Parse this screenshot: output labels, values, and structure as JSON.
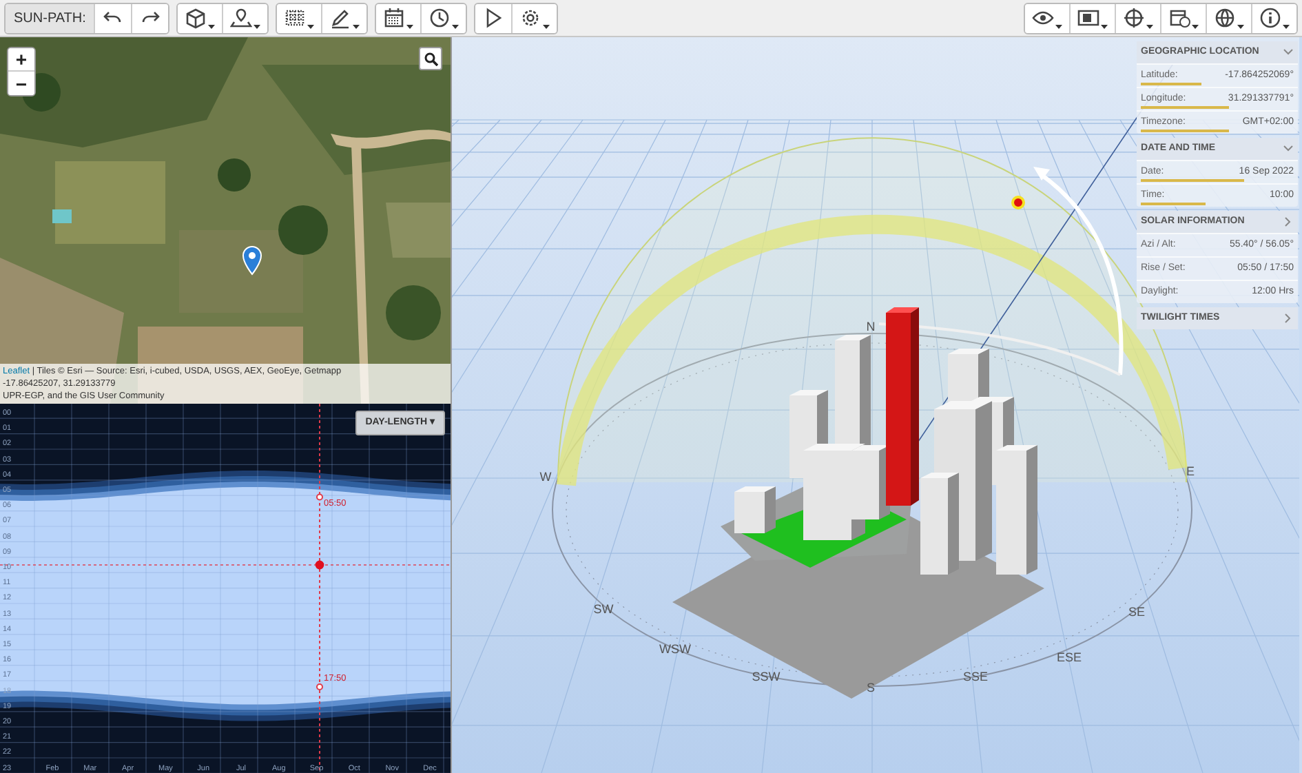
{
  "toolbar": {
    "title": "SUN-PATH:"
  },
  "map": {
    "zoom_in": "+",
    "zoom_out": "−",
    "attribution_link": "Leaflet",
    "attribution": "| Tiles © Esri — Source: Esri, i-cubed, USDA, USGS, AEX, GeoEye, Getmapp",
    "coordinates": "-17.86425207, 31.29133779",
    "attribution_line2": "UPR-EGP, and the GIS User Community"
  },
  "day_length": {
    "dropdown": "DAY-LENGTH ▾",
    "hours": [
      "00",
      "01",
      "02",
      "03",
      "04",
      "05",
      "06",
      "07",
      "08",
      "09",
      "10",
      "11",
      "12",
      "13",
      "14",
      "15",
      "16",
      "17",
      "18",
      "19",
      "20",
      "21",
      "22",
      "23"
    ],
    "months": [
      "Feb",
      "Mar",
      "Apr",
      "May",
      "Jun",
      "Jul",
      "Aug",
      "Sep",
      "Oct",
      "Nov",
      "Dec"
    ],
    "sunrise_label": "05:50",
    "sunset_label": "17:50"
  },
  "compass": [
    {
      "label": "N"
    },
    {
      "label": "S"
    },
    {
      "label": "E"
    },
    {
      "label": "W"
    },
    {
      "label": "SE"
    },
    {
      "label": "SW"
    },
    {
      "label": "SSE"
    },
    {
      "label": "SSW"
    },
    {
      "label": "ESE"
    },
    {
      "label": "WSW"
    }
  ],
  "panel": [
    {
      "title": "GEOGRAPHIC LOCATION",
      "expanded": true,
      "rows": [
        {
          "label": "Latitude:",
          "value": "-17.864252069°",
          "level": 0.4
        },
        {
          "label": "Longitude:",
          "value": "31.291337791°",
          "level": 0.58
        },
        {
          "label": "Timezone:",
          "value": "GMT+02:00",
          "level": 0.58
        }
      ]
    },
    {
      "title": "DATE AND TIME",
      "expanded": true,
      "rows": [
        {
          "label": "Date:",
          "value": "16 Sep 2022",
          "level": 0.68
        },
        {
          "label": "Time:",
          "value": "10:00",
          "level": 0.42
        }
      ]
    },
    {
      "title": "SOLAR INFORMATION",
      "expanded": false,
      "rows": [
        {
          "label": "Azi / Alt:",
          "value": "55.40° / 56.05°"
        },
        {
          "label": "Rise / Set:",
          "value": "05:50 / 17:50"
        },
        {
          "label": "Daylight:",
          "value": "12:00 Hrs"
        }
      ]
    },
    {
      "title": "TWILIGHT TIMES",
      "expanded": false
    }
  ]
}
